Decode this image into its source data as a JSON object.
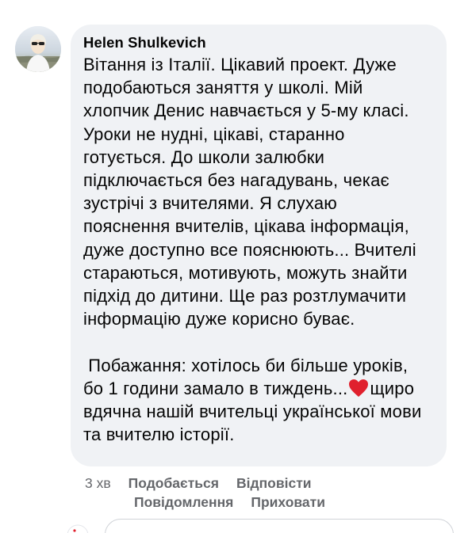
{
  "comment": {
    "author": "Helen Shulkevich",
    "text_lines": [
      "Вітання із Італії. Цікавий проект. Дуже",
      "подобаються заняття у школі. Мій",
      "хлопчик Денис навчається у 5-му класі.",
      "Уроки не нудні, цікаві, старанно",
      "готується. До школи залюбки",
      "підключається без нагадувань, чекає",
      "зустрічі з вчителями. Я слухаю",
      "пояснення вчителів, цікава інформація,",
      "дуже доступно все пояснюють... Вчителі",
      "стараються, мотивують, можуть знайти",
      "підхід до дитини. Ще раз розтлумачити",
      "інформацію дуже корисно буває.",
      " ",
      " Побажання: хотілось би більше уроків,",
      "бо 1 години замало в тиждень...",
      "щиро",
      "вдячна нашій вчительці української мови",
      "та вчителю історії."
    ],
    "heart_icon": "red-heart-icon",
    "heart_color": "#e0202d"
  },
  "actions": {
    "time": "3 хв",
    "like": "Подобається",
    "reply": "Відповісти",
    "message": "Повідомлення",
    "hide": "Приховати"
  },
  "colors": {
    "bubble": "#f0f2f5",
    "text": "#050505",
    "secondary": "#65676b"
  }
}
